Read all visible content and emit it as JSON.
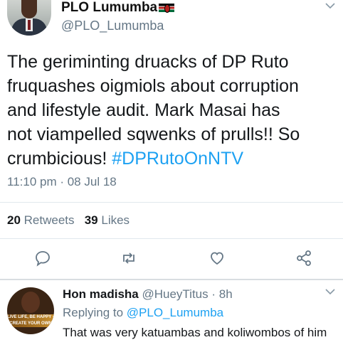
{
  "tweet": {
    "display_name": "PLO Lumumba",
    "handle": "@PLO_Lumumba",
    "text": "The geriminting druacks of DP Ruto\nfruquashes oigmiols about corruption\nand lifestyle audit. Mark Masai has\nnot viampelled sqwenks of prulls!! So\ncrumbicious! ",
    "hashtag": "#DPRutoOnNTV",
    "timestamp": "11:10 pm · 08 Jul 18",
    "retweets_count": "20",
    "retweets_label": "Retweets",
    "likes_count": "39",
    "likes_label": "Likes",
    "flag_icon": "kenya-flag-icon"
  },
  "actions": [
    "reply-icon",
    "retweet-icon",
    "like-icon",
    "share-icon"
  ],
  "reply": {
    "display_name": "Hon madisha",
    "handle_time": "@HueyTitus · 8h",
    "replying_prefix": "Replying to ",
    "replying_to": "@PLO_Lumumba",
    "text": "That was very katuambas and koliwombos of him",
    "avatar_text": "LIVE LIFE, BE HAPPY · CREATE YOUR OWN"
  },
  "colors": {
    "accent": "#1da1f2",
    "secondary_text": "#657786",
    "icon": "#657786"
  }
}
